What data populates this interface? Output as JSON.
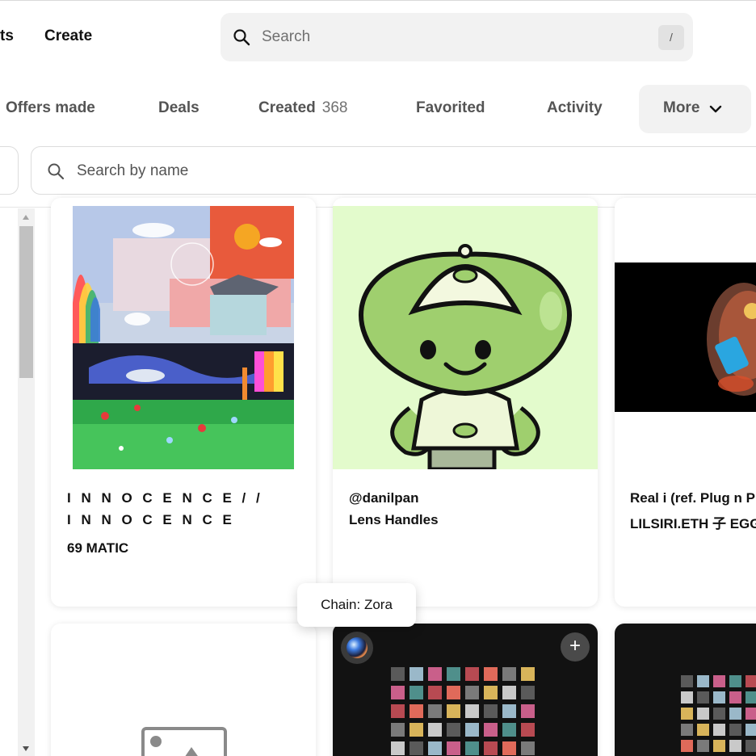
{
  "header": {
    "nav_partial": "ts",
    "nav_create": "Create",
    "search_placeholder": "Search",
    "search_shortcut": "/"
  },
  "tabs": [
    {
      "label": "Offers made"
    },
    {
      "label": "Deals"
    },
    {
      "label": "Created",
      "count": "368"
    },
    {
      "label": "Favorited"
    },
    {
      "label": "Activity"
    },
    {
      "label": "More"
    }
  ],
  "filter": {
    "search_placeholder": "Search by name"
  },
  "cards": [
    {
      "title_line1": "I N N O C E N C E / /",
      "title_line2": "I N N O C E N C E",
      "price": "69 MATIC"
    },
    {
      "title": "@danilpan",
      "collection": "Lens Handles"
    },
    {
      "title": "Real i (ref. Plug n P",
      "collection": "LILSIRI.ETH 子 EGG"
    }
  ],
  "tooltip": {
    "text": "Chain: Zora"
  },
  "icons": {
    "search": "search-icon",
    "chevron": "chevron-down-icon",
    "add": "plus-icon",
    "chain": "zora-chain-icon",
    "placeholder": "image-placeholder-icon"
  },
  "colors": {
    "card_bg": "#ffffff",
    "pill_bg": "#f2f2f2",
    "text": "#121212",
    "muted": "#545454",
    "green_bg": "#e3fbcc"
  }
}
